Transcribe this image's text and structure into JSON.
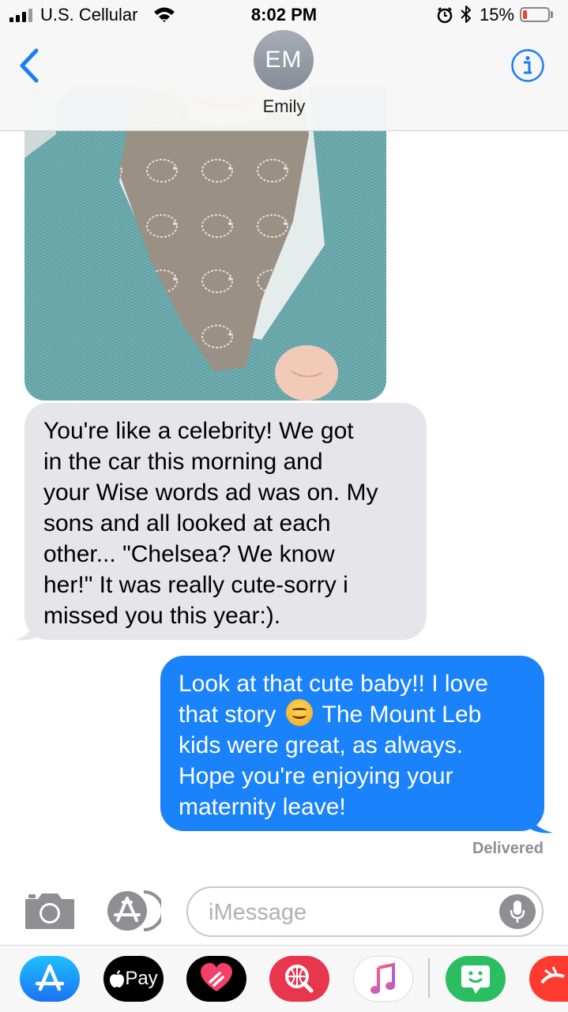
{
  "status_bar": {
    "carrier": "U.S. Cellular",
    "time": "8:02 PM",
    "battery_percent": "15%",
    "battery_level": 0.15,
    "icons": [
      "signal-icon",
      "wifi-icon",
      "alarm-icon",
      "bluetooth-icon",
      "battery-icon"
    ]
  },
  "header": {
    "avatar_initials": "EM",
    "contact_name": "Emily",
    "back_icon": "chevron-left-icon",
    "info_icon": "info-icon"
  },
  "conversation": {
    "photo": "baby-photo",
    "incoming_message": {
      "lines": [
        "You're like a celebrity!  We got",
        "in the car this morning and",
        "your Wise words ad was on. My",
        "sons and all looked at each",
        "other... \"Chelsea? We know",
        "her!\"  It was really cute-sorry i",
        "missed you this year:)."
      ]
    },
    "outgoing_message": {
      "lines": [
        "Look at that cute baby!! I love",
        "that story",
        "The Mount Leb",
        "kids were great, as always.",
        "Hope you're enjoying your",
        "maternity leave!"
      ]
    },
    "delivered_label": "Delivered"
  },
  "input_bar": {
    "placeholder": "iMessage",
    "camera_icon": "camera-icon",
    "apps_icon": "app-store-icon",
    "mic_icon": "microphone-icon"
  },
  "app_drawer": {
    "apps": [
      {
        "name": "app-store-icon"
      },
      {
        "name": "apple-pay-icon",
        "label": "Pay"
      },
      {
        "name": "digital-touch-icon"
      },
      {
        "name": "web-images-icon"
      },
      {
        "name": "music-icon"
      },
      {
        "name": "bitmoji-icon"
      },
      {
        "name": "more-app-icon"
      }
    ]
  },
  "colors": {
    "ios_blue": "#1a82fb",
    "incoming_bubble": "#e6e6ea",
    "battery_low": "#ff3b30"
  }
}
